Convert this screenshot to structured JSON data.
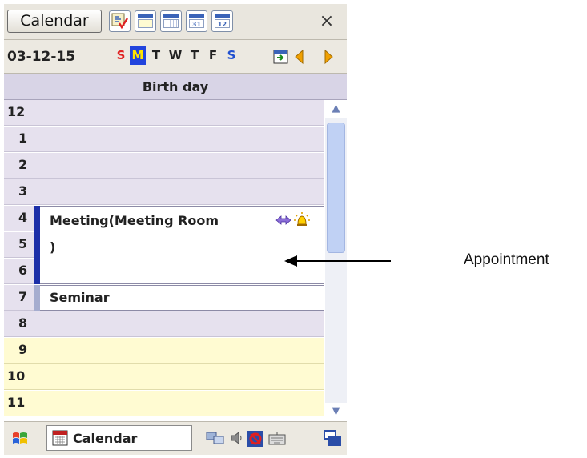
{
  "titlebar": {
    "app_button": "Calendar",
    "view_icons": [
      "agenda-view-icon",
      "day-view-icon",
      "week-view-icon",
      "month-view-icon",
      "year-view-icon"
    ],
    "view_icon_labels": [
      "",
      "",
      "",
      "31",
      "12"
    ],
    "close": "×"
  },
  "datebar": {
    "date": "03-12-15",
    "days": [
      {
        "label": "S",
        "kind": "sun"
      },
      {
        "label": "M",
        "kind": "selected"
      },
      {
        "label": "T",
        "kind": "weekday"
      },
      {
        "label": "W",
        "kind": "weekday"
      },
      {
        "label": "T",
        "kind": "weekday"
      },
      {
        "label": "F",
        "kind": "weekday"
      },
      {
        "label": "S",
        "kind": "sat"
      }
    ],
    "nav_icons": [
      "goto-today-icon",
      "previous-arrow-icon",
      "next-arrow-icon"
    ]
  },
  "all_day_event": "Birth day",
  "hours": [
    "12",
    "1",
    "2",
    "3",
    "4",
    "5",
    "6",
    "7",
    "8",
    "9",
    "10",
    "11"
  ],
  "appointments": [
    {
      "line1": "Meeting(Meeting Room",
      "line2": ")",
      "icons": [
        "recurrence-icon",
        "reminder-bell-icon"
      ]
    },
    {
      "line1": "Seminar"
    }
  ],
  "taskbar": {
    "start_icon": "start-flag-icon",
    "task_label": "Calendar",
    "tray_icons": [
      "network-icon",
      "volume-icon",
      "sync-icon",
      "keyboard-icon",
      "switch-window-icon"
    ]
  },
  "callout": "Appointment",
  "colors": {
    "selected_day_bg": "#2244dd",
    "selected_day_fg": "#ffe400",
    "sunday": "#e02020",
    "saturday": "#2050d0",
    "non_work_hours": "#e6e1ee",
    "work_hours": "#fffbd2",
    "appointment_bar": "#1c2fa8"
  }
}
